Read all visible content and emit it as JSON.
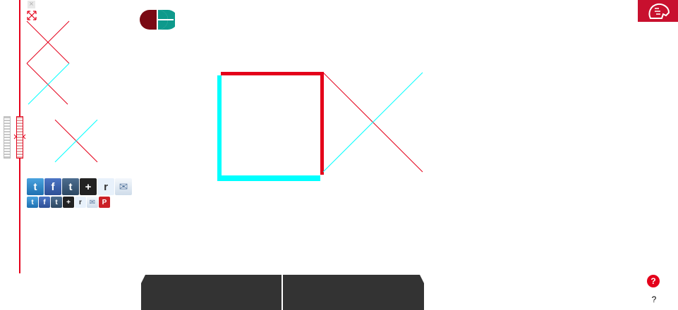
{
  "toolbar": {
    "close_glyph": "×",
    "expand_icon": "expand-icon"
  },
  "logos": {
    "brand_mark": "brand-logo-icon",
    "nypl_mark": "nypl-lion-logo-icon"
  },
  "share_large": [
    {
      "name": "twitter",
      "glyph": "t"
    },
    {
      "name": "facebook",
      "glyph": "f"
    },
    {
      "name": "tumblr",
      "glyph": "t"
    },
    {
      "name": "google-plus",
      "glyph": "+"
    },
    {
      "name": "reddit",
      "glyph": "r"
    },
    {
      "name": "email",
      "glyph": "✉"
    }
  ],
  "share_small": [
    {
      "name": "twitter",
      "glyph": "t"
    },
    {
      "name": "facebook",
      "glyph": "f"
    },
    {
      "name": "tumblr",
      "glyph": "t"
    },
    {
      "name": "google-plus",
      "glyph": "+"
    },
    {
      "name": "reddit",
      "glyph": "r"
    },
    {
      "name": "email",
      "glyph": "✉"
    },
    {
      "name": "pinterest",
      "glyph": "P"
    }
  ],
  "help": {
    "button_glyph": "?",
    "text": "?"
  },
  "colors": {
    "red": "#e4001a",
    "cyan": "#00ffff",
    "dark": "#333333"
  }
}
